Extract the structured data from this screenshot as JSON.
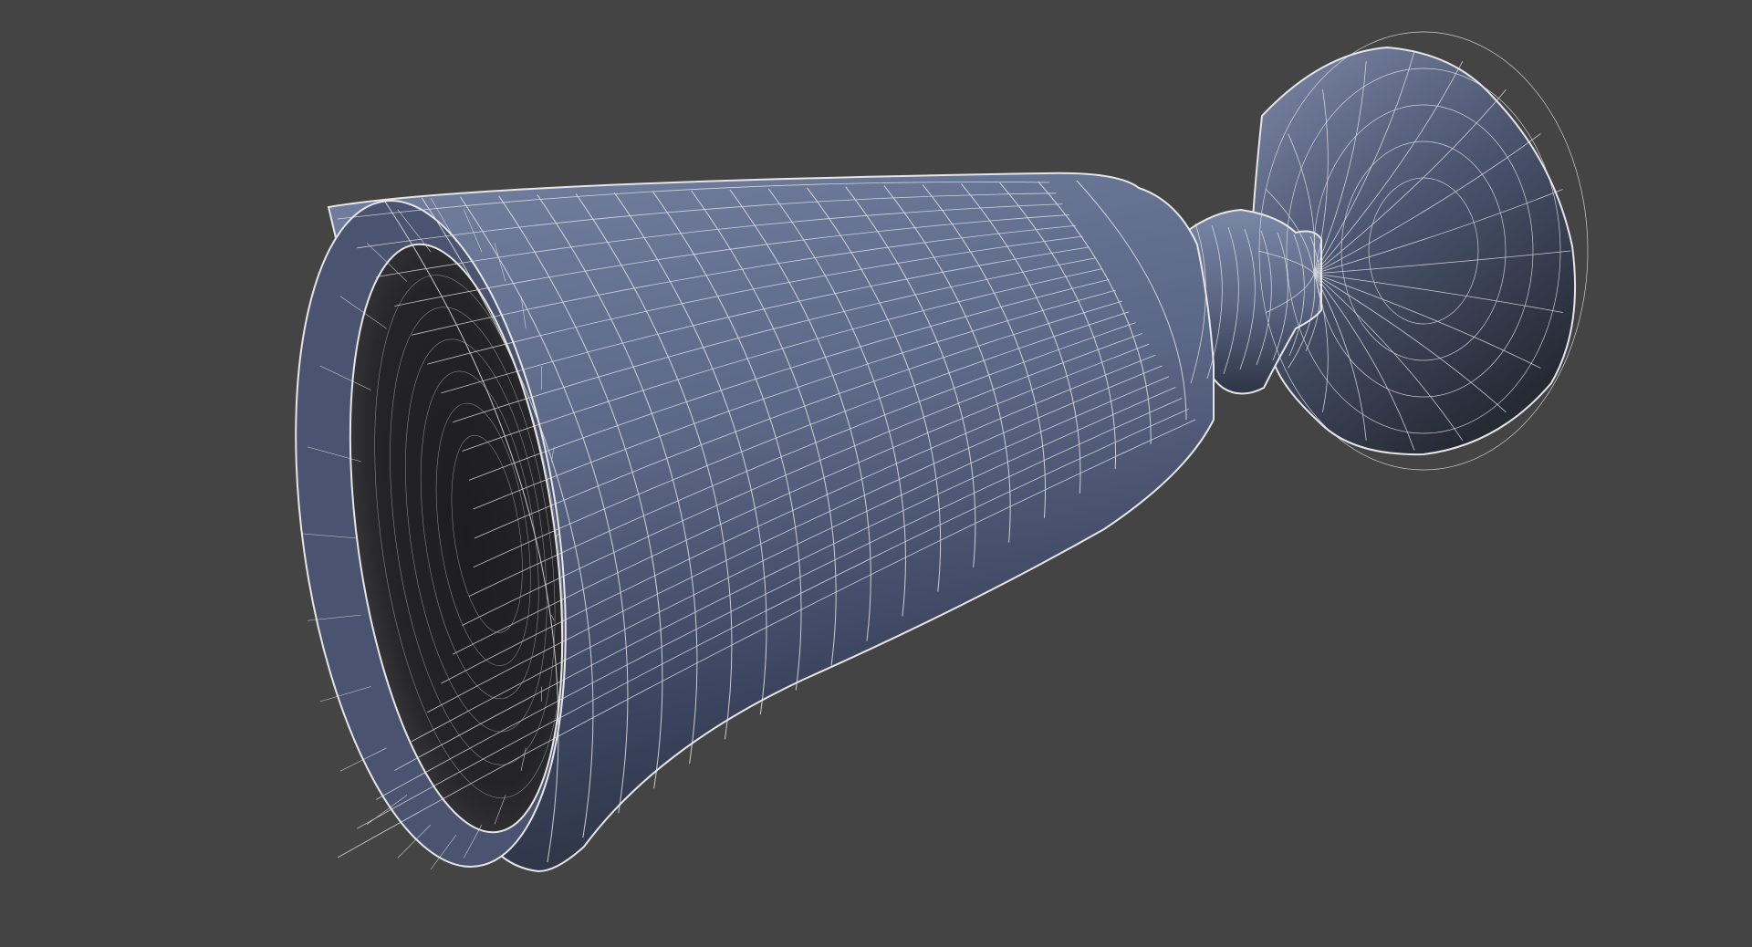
{
  "viewport": {
    "background_color": "#444444",
    "mesh_shading": {
      "body_light": "#6a7898",
      "body_mid": "#56627f",
      "body_dark": "#36405a",
      "interior_dark": "#202022",
      "wire_color": "#e6e6e6"
    },
    "object": {
      "kind": "wireframe-mesh",
      "shape": "goblet-lying-on-side"
    }
  }
}
